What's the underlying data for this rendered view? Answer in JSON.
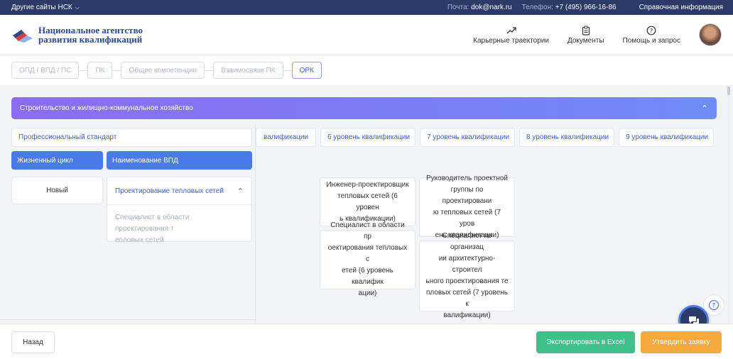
{
  "topbar": {
    "other_sites": "Другие сайты НСК",
    "mail_label": "Почта:",
    "mail_value": "dok@nark.ru",
    "phone_label": "Телефон:",
    "phone_value": "+7 (495) 966-16-86",
    "info": "Справочная информация"
  },
  "header": {
    "logo_line1": "Национальное агентство",
    "logo_line2": "развития квалификаций",
    "nav": [
      {
        "label": "Карьерные траектории",
        "icon": "trend-up-icon"
      },
      {
        "label": "Документы",
        "icon": "clipboard-icon"
      },
      {
        "label": "Помощь и запрос",
        "icon": "question-circle-icon"
      }
    ]
  },
  "steps": [
    {
      "label": "ОПД / ВПД / ПС",
      "active": false
    },
    {
      "label": "ПК",
      "active": false
    },
    {
      "label": "Общие компетенции",
      "active": false
    },
    {
      "label": "Взаимосвязи ПК",
      "active": false
    },
    {
      "label": "ОРК",
      "active": true
    }
  ],
  "section": {
    "title": "Строительство и жилищно-коммунальное хозяйство"
  },
  "left": {
    "standard": "Профессиональный стандарт",
    "col_cycle": "Жизненный цикл",
    "col_vpd": "Наименование ВПД",
    "cycle_value": "Новый",
    "vpd_title": "Проектирование тепловых сетей",
    "vpd_body_1": "Специалист в области проектирования т",
    "vpd_body_2": "епловых сетей"
  },
  "levels": [
    "валификации",
    "6 уровень квалификации",
    "7 уровень квалификации",
    "8 уровень квалификации",
    "9 уровень квалификации"
  ],
  "jobs": {
    "l6_a": [
      "Инженер-проектировщик",
      "тепловых сетей (6 уровен",
      "ь квалификации)"
    ],
    "l6_b": [
      "Специалист в области пр",
      "оектирования тепловых с",
      "етей (6 уровень квалифик",
      "ации)"
    ],
    "l7_a": [
      "Руководитель проектной",
      "группы по проектировани",
      "ю тепловых сетей (7 уров",
      "ень квалификации)"
    ],
    "l7_b": [
      "Специалист по организац",
      "ии архитектурно-строител",
      "ьного проектирования те",
      "пловых сетей (7 уровень к",
      "валификации)"
    ]
  },
  "footer": {
    "back": "Назад",
    "export": "Экспортировать в Excel",
    "approve": "Утвердить заявку"
  },
  "colors": {
    "topbar": "#2b3a67",
    "accent": "#4a79e8",
    "export": "#3fc28a",
    "approve": "#f7a93b"
  }
}
